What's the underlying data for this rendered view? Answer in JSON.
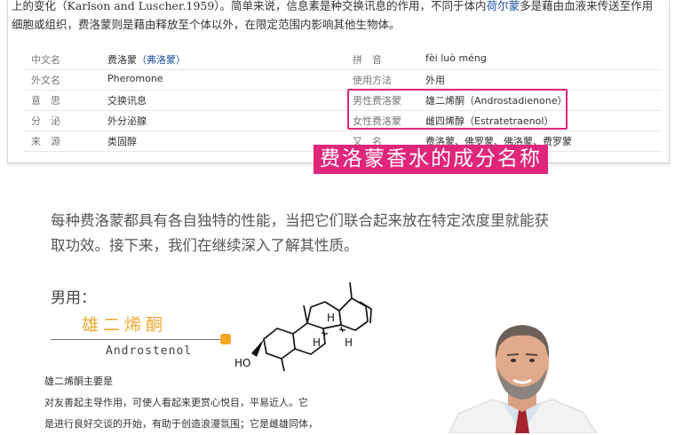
{
  "intro": {
    "line1_a": "上的变化（Karlson and Luscher.1959）。简单来说，信息素是种交换讯息的作用，不同于体内",
    "line1_link": "荷尔蒙",
    "line1_b": "多是藉由血液来传送至作用",
    "line2": "细胞或组织，费洛蒙则是藉由释放至个体以外，在限定范围内影响其他生物体。"
  },
  "info_table": {
    "rows": [
      {
        "left_label": "中文名",
        "left_value": "费洛蒙",
        "left_value_alt": "（弗洛蒙）",
        "right_label": "拼　音",
        "right_value": "fèi luò méng"
      },
      {
        "left_label": "外文名",
        "left_value": "Pheromone",
        "right_label": "使用方法",
        "right_value": "外用"
      },
      {
        "left_label": "意　思",
        "left_value": "交换讯息",
        "right_label": "男性费洛蒙",
        "right_value": "雄二烯酮（Androstadienone）"
      },
      {
        "left_label": "分　泌",
        "left_value": "外分泌腺",
        "right_label": "女性费洛蒙",
        "right_value": "雌四烯醇（Estratetraenol）"
      },
      {
        "left_label": "来　源",
        "left_value": "类固醇",
        "right_label": "又　名",
        "right_value": "费洛蒙、佛罗蒙、佛洛蒙、费罗蒙"
      }
    ]
  },
  "banner": "费洛蒙香水的成分名称",
  "paragraph": {
    "line1": "每种费洛蒙都具有各自独特的性能，当把它们联合起来放在特定浓度里就能获",
    "line2": "取功效。接下来，我们在继续深入了解其性质。"
  },
  "male_section": {
    "heading": "男用：",
    "chinese_name": "雄二烯酮",
    "english_name": "Androstenol",
    "description": [
      "雄二烯酮主要是",
      "对友善起主导作用，可使人看起来更赏心悦目，平易近人。它",
      "是进行良好交谈的开始，有助于创造浪漫氛围；它是雌雄同体，"
    ]
  },
  "molecule": {
    "labels": {
      "h1": "H",
      "h2": "H",
      "h3": "H",
      "ho": "HO"
    }
  },
  "colors": {
    "accent_pink": "#e0267b",
    "accent_orange": "#f0a830",
    "link_blue": "#1e50a2"
  }
}
